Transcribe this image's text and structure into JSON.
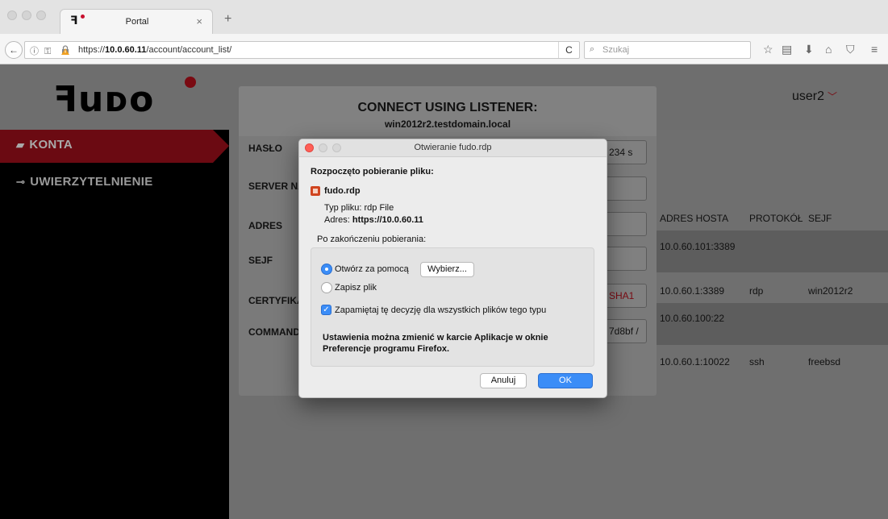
{
  "browser": {
    "tab_title": "Portal",
    "tab_close": "×",
    "new_tab": "+",
    "back": "←",
    "url_icons": "ⓘ ⚿",
    "url_prefix": "https://",
    "url_host": "10.0.60.11",
    "url_path": "/account/account_list/",
    "reload": "C",
    "search_icon": "⌕",
    "search_placeholder": "Szukaj",
    "toolbar_icons": [
      "☆",
      "▤",
      "⬇",
      "⌂",
      "⛉",
      "≡"
    ]
  },
  "app": {
    "logo": "ꟻuᴅo",
    "user": "user2",
    "user_chevron": "﹀"
  },
  "sidebar": {
    "items": [
      {
        "icon": "▰",
        "label": "KONTA",
        "active": true
      },
      {
        "icon": "⊸",
        "label": "UWIERZYTELNIENIE",
        "active": false
      }
    ]
  },
  "table": {
    "headers": [
      "ADRES HOSTA",
      "PROTOKÓŁ",
      "SEJF"
    ],
    "rows": [
      {
        "host": "10.0.60.101:3389",
        "protocol": "",
        "safe": ""
      },
      {
        "host": "10.0.60.1:3389",
        "protocol": "rdp",
        "safe": "win2012r2"
      },
      {
        "host": "10.0.60.100:22",
        "protocol": "",
        "safe": ""
      },
      {
        "host": "10.0.60.1:10022",
        "protocol": "ssh",
        "safe": "freebsd"
      }
    ]
  },
  "listener": {
    "title": "CONNECT USING LISTENER:",
    "subtitle": "win2012r2.testdomain.local",
    "labels": [
      "HASŁO",
      "SERVER NA",
      "ADRES",
      "SEJF",
      "CERTYFIKA",
      "COMMAND"
    ],
    "fields": [
      "234 s",
      "",
      "",
      "",
      "SHA1",
      "7d8bf /"
    ]
  },
  "download_dialog": {
    "title": "Otwieranie fudo.rdp",
    "started": "Rozpoczęto pobieranie pliku:",
    "file_name": "fudo.rdp",
    "file_type": "Typ pliku: rdp File",
    "address_label": "Adres:",
    "address_value": "https://10.0.60.11",
    "after_download": "Po zakończeniu pobierania:",
    "open_with": "Otwórz za pomocą",
    "choose_button": "Wybierz...",
    "save_file": "Zapisz plik",
    "remember": "Zapamiętaj tę decyzję dla wszystkich plików tego typu",
    "note_line1": "Ustawienia można zmienić w karcie Aplikacje w oknie",
    "note_line2": "Preferencje programu Firefox.",
    "cancel": "Anuluj",
    "ok": "OK",
    "selected_option": "open_with",
    "remember_checked": true
  },
  "colors": {
    "accent_red": "#6b0a12",
    "mac_blue": "#3b8df7",
    "close_red": "#ff5f57"
  }
}
